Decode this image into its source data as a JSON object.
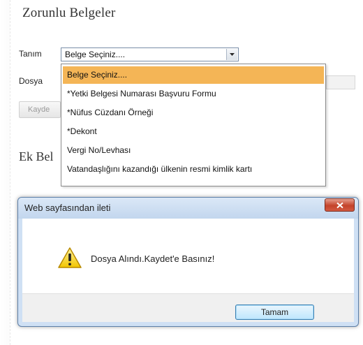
{
  "page": {
    "title": "Zorunlu Belgeler",
    "section_title": "Ek Bel"
  },
  "form": {
    "tanim_label": "Tanım",
    "dosya_label": "Dosya",
    "selected_value": "Belge Seçiniz....",
    "kaydet_label": "Kayde"
  },
  "dropdown": {
    "options": [
      "Belge Seçiniz....",
      "*Yetki Belgesi Numarası Başvuru Formu",
      "*Nüfus Cüzdanı Örneği",
      "*Dekont",
      "Vergi No/Levhası",
      "Vatandaşlığını kazandığı ülkenin resmi kimlik kartı"
    ],
    "highlight_color": "#f4b556"
  },
  "dialog": {
    "title": "Web sayfasından ileti",
    "message": "Dosya Alındı.Kaydet'e Basınız!",
    "ok_label": "Tamam",
    "icon": "warning-icon",
    "close_icon": "close-icon"
  }
}
